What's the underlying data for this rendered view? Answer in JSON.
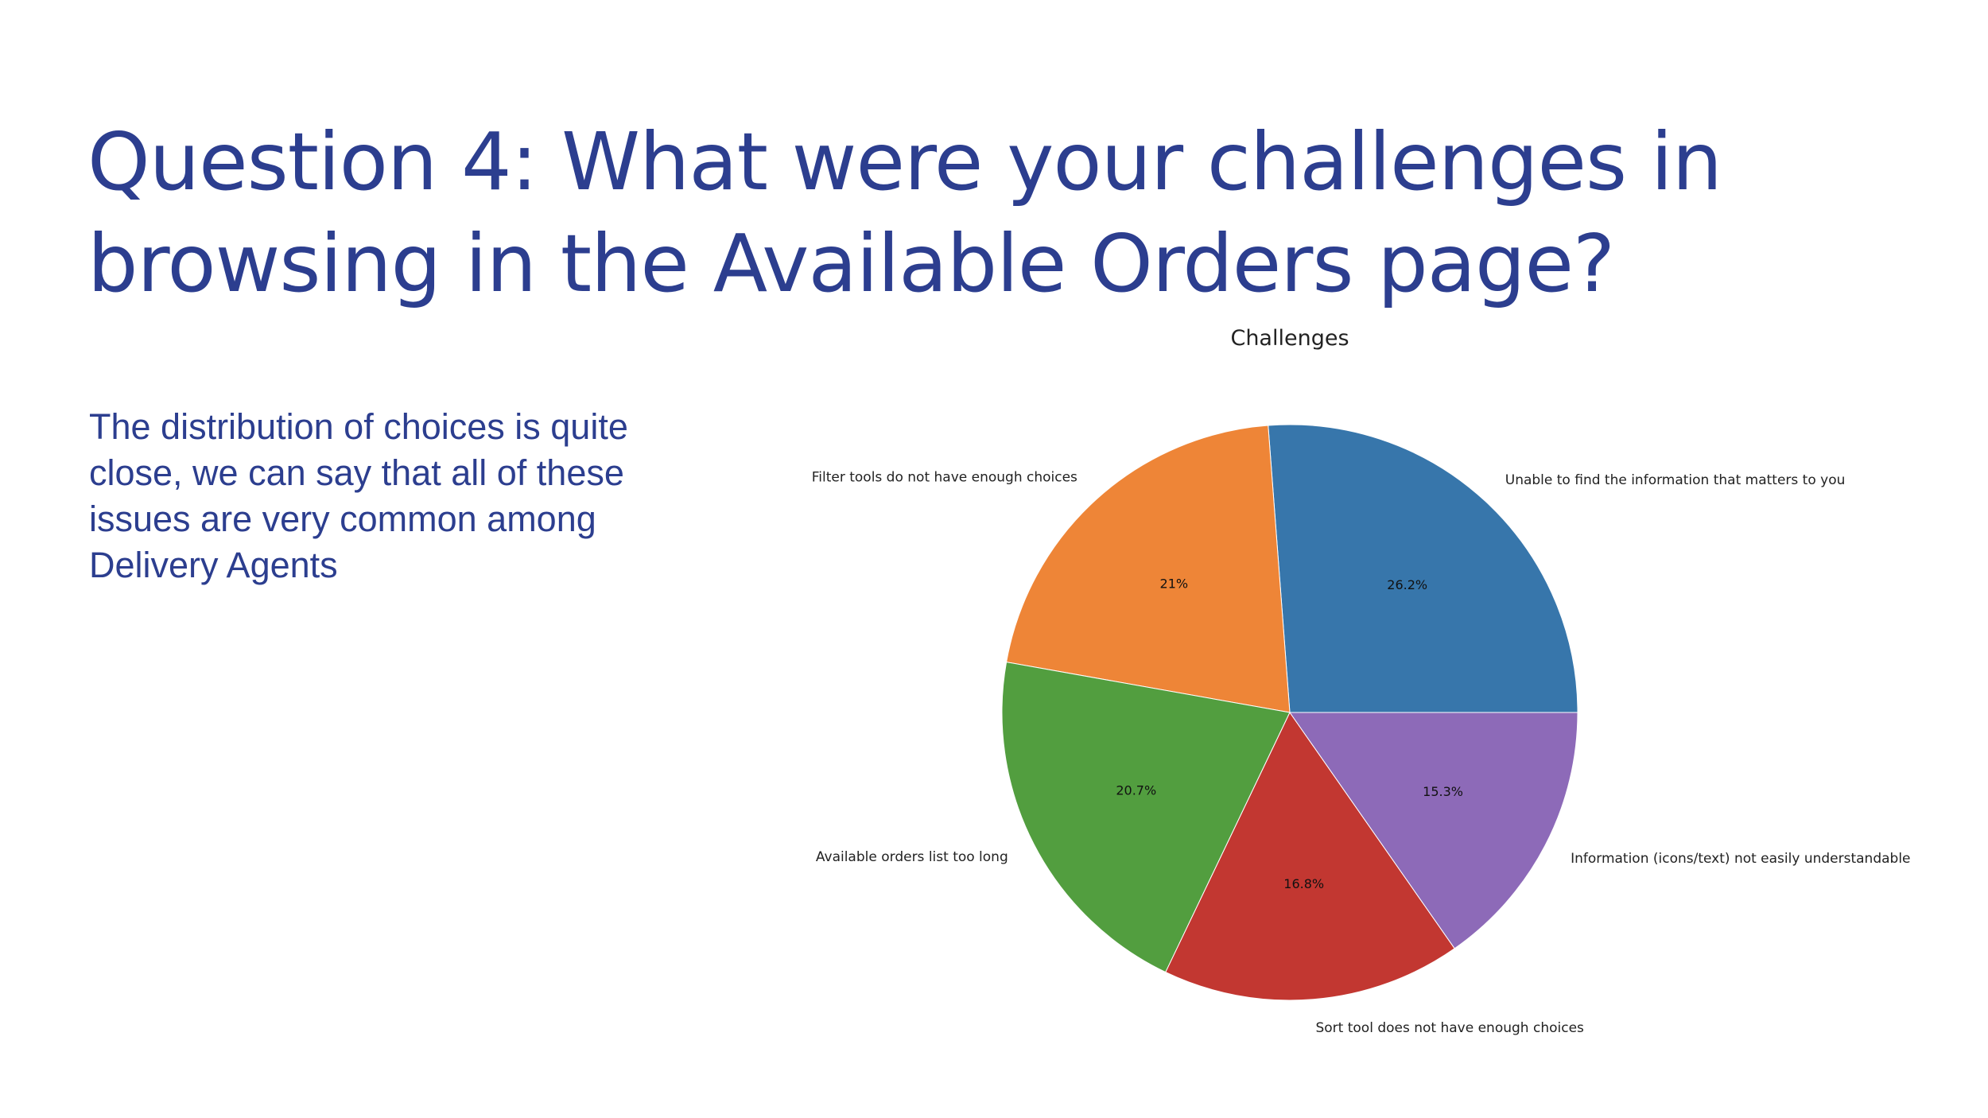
{
  "slide": {
    "title_lines": [
      "Question 4: What were your challenges in",
      "browsing in the Available Orders page?"
    ],
    "body_lines": [
      "The distribution of choices is quite",
      "close, we can say that all of these",
      "issues are very common among",
      "Delivery Agents"
    ]
  },
  "chart_data": {
    "type": "pie",
    "title": "Challenges",
    "start_angle_deg": 0,
    "direction": "counterclockwise",
    "slices": [
      {
        "label": "Unable to find the information that matters to you",
        "value": 26.2,
        "pct_label": "26.2%",
        "color": "#3776ab"
      },
      {
        "label": "Filter tools do not have enough choices",
        "value": 21.0,
        "pct_label": "21%",
        "color": "#ee8537"
      },
      {
        "label": "Available orders list too long",
        "value": 20.7,
        "pct_label": "20.7%",
        "color": "#529e3f"
      },
      {
        "label": "Sort tool does not have enough choices",
        "value": 16.8,
        "pct_label": "16.8%",
        "color": "#c23731"
      },
      {
        "label": "Information (icons/text) not easily understandable",
        "value": 15.3,
        "pct_label": "15.3%",
        "color": "#8d6ab8"
      }
    ]
  }
}
